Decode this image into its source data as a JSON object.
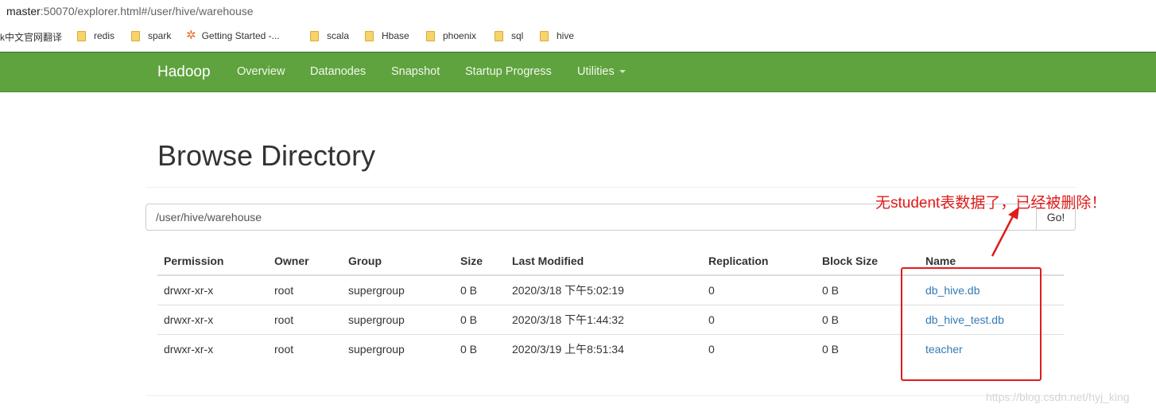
{
  "browser": {
    "url_host": "master",
    "url_rest": ":50070/explorer.html#/user/hive/warehouse",
    "bookmarks": [
      {
        "label": "k中文官网翻译",
        "icon": "none"
      },
      {
        "label": "redis",
        "icon": "folder-icon"
      },
      {
        "label": "spark",
        "icon": "folder-icon"
      },
      {
        "label": "Getting Started -...",
        "icon": "star-icon"
      },
      {
        "label": "scala",
        "icon": "folder-icon"
      },
      {
        "label": "Hbase",
        "icon": "folder-icon"
      },
      {
        "label": "phoenix",
        "icon": "folder-icon"
      },
      {
        "label": "sql",
        "icon": "folder-icon"
      },
      {
        "label": "hive",
        "icon": "folder-icon"
      }
    ]
  },
  "navbar": {
    "brand": "Hadoop",
    "items": [
      "Overview",
      "Datanodes",
      "Snapshot",
      "Startup Progress",
      "Utilities"
    ],
    "color": "#5fa33e"
  },
  "page": {
    "title": "Browse Directory",
    "path_value": "/user/hive/warehouse",
    "go_label": "Go!"
  },
  "table": {
    "headers": [
      "Permission",
      "Owner",
      "Group",
      "Size",
      "Last Modified",
      "Replication",
      "Block Size",
      "Name"
    ],
    "rows": [
      [
        "drwxr-xr-x",
        "root",
        "supergroup",
        "0 B",
        "2020/3/18 下午5:02:19",
        "0",
        "0 B",
        "db_hive.db"
      ],
      [
        "drwxr-xr-x",
        "root",
        "supergroup",
        "0 B",
        "2020/3/18 下午1:44:32",
        "0",
        "0 B",
        "db_hive_test.db"
      ],
      [
        "drwxr-xr-x",
        "root",
        "supergroup",
        "0 B",
        "2020/3/19 上午8:51:34",
        "0",
        "0 B",
        "teacher"
      ]
    ]
  },
  "annotation": {
    "text": "无student表数据了，已经被删除！",
    "color": "#e01b1b"
  },
  "watermark": "https://blog.csdn.net/hyj_king"
}
